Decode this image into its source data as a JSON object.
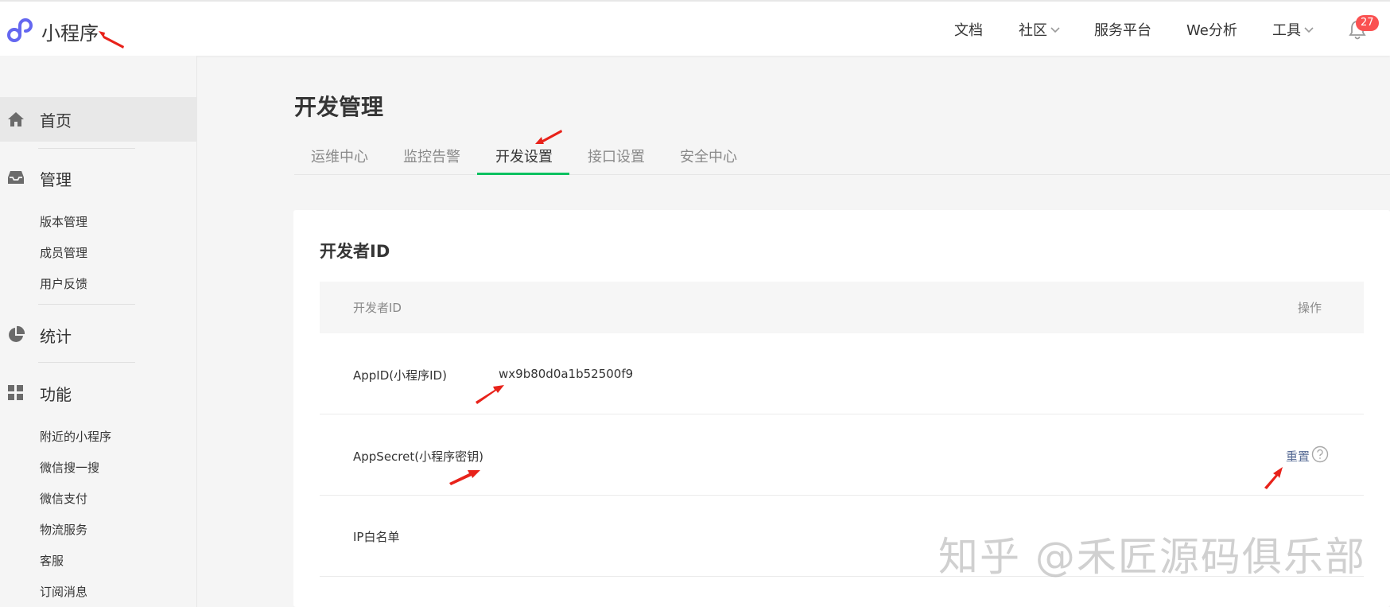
{
  "header": {
    "brand": "小程序",
    "nav": [
      {
        "label": "文档",
        "has_dropdown": false
      },
      {
        "label": "社区",
        "has_dropdown": true
      },
      {
        "label": "服务平台",
        "has_dropdown": false
      },
      {
        "label": "We分析",
        "has_dropdown": false
      },
      {
        "label": "工具",
        "has_dropdown": true
      }
    ],
    "notification_count": "27",
    "icons": {
      "logo": "miniprogram-logo-icon",
      "bell": "bell-icon",
      "chevron": "chevron-down-icon"
    }
  },
  "sidebar": {
    "sections": [
      {
        "label": "首页",
        "icon": "home-icon",
        "active": true,
        "items": []
      },
      {
        "label": "管理",
        "icon": "inbox-icon",
        "items": [
          "版本管理",
          "成员管理",
          "用户反馈"
        ]
      },
      {
        "label": "统计",
        "icon": "pie-chart-icon",
        "items": []
      },
      {
        "label": "功能",
        "icon": "grid-icon",
        "items": [
          "附近的小程序",
          "微信搜一搜",
          "微信支付",
          "物流服务",
          "客服",
          "订阅消息"
        ]
      }
    ]
  },
  "main": {
    "title": "开发管理",
    "tabs": [
      {
        "label": "运维中心",
        "active": false
      },
      {
        "label": "监控告警",
        "active": false
      },
      {
        "label": "开发设置",
        "active": true
      },
      {
        "label": "接口设置",
        "active": false
      },
      {
        "label": "安全中心",
        "active": false
      }
    ],
    "card": {
      "title": "开发者ID",
      "columns": [
        "开发者ID",
        "操作"
      ],
      "rows": [
        {
          "label": "AppID(小程序ID)",
          "value": "wx9b80d0a1b52500f9",
          "action": ""
        },
        {
          "label": "AppSecret(小程序密钥)",
          "value": "",
          "action": "重置"
        },
        {
          "label": "IP白名单",
          "value": "",
          "action": ""
        }
      ]
    }
  },
  "watermark": "知乎 @禾匠源码俱乐部",
  "colors": {
    "accent": "#07c160",
    "link": "#576b95",
    "badge": "#fa5151",
    "annotation": "#e8221a"
  }
}
